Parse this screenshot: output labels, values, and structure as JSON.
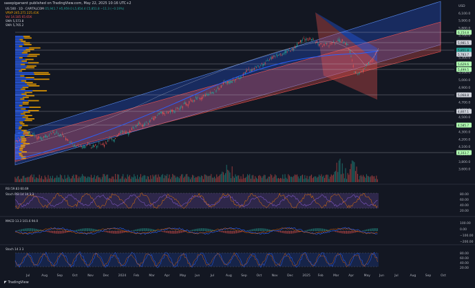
{
  "header": {
    "title": "sasepigarsent published on TradingView.com, May 22, 2025 10:16 UTC+2"
  },
  "legend": {
    "symbol_line": "US 500 · 1D · CAPITALCOM",
    "ohlc": "O5,941.7 H5,959.0 L5,854.4 C5,851.8 −11.3 (−0.19%)",
    "vrvp": "VRVP 245.271 225.41K",
    "vol": "Vol 14.185 65.65K",
    "sma1": "SMA 5,573.8",
    "sma2": "SMA 5,765.2"
  },
  "colors": {
    "background": "#131722",
    "up": "#26a69a",
    "down": "#ef5350",
    "channel_blue": "#2962ff",
    "channel_red": "#ef5350",
    "profile": "#f7a600",
    "ma": "#2962ff"
  },
  "y_axis": {
    "labels": [
      "USD",
      "6,100.0",
      "5,900.0",
      "5,800.0",
      "5,700.0",
      "5,600.0",
      "5,500.0",
      "5,300.0",
      "5,200.0",
      "5,100.0",
      "5,000.0",
      "4,900.0",
      "4,800.0",
      "4,700.0",
      "4,600.0",
      "4,500.0",
      "4,400.0",
      "4,300.0",
      "4,200.0",
      "4,100.0",
      "4,000.0",
      "3,800.0",
      "3,600.0"
    ],
    "price_tags": [
      {
        "text": "6,154.8",
        "color": "#b2ffb2"
      },
      {
        "text": "5,981.5",
        "color": "#d1d4dc"
      },
      {
        "text": "5,851.8",
        "color": "#26a69a"
      },
      {
        "text": "5,783.7",
        "color": "#d1d4dc"
      },
      {
        "text": "5,629.6",
        "color": "#b2ffb2"
      },
      {
        "text": "5,499.5",
        "color": "#b2ffb2"
      },
      {
        "text": "5,068.8",
        "color": "#d1d4dc"
      },
      {
        "text": "4,807.1",
        "color": "#d1d4dc"
      },
      {
        "text": "4,585.7",
        "color": "#b2ffb2"
      },
      {
        "text": "4,103.7",
        "color": "#b2ffb2"
      }
    ]
  },
  "x_axis": {
    "labels": [
      "Jul",
      "Aug",
      "Sep",
      "Oct",
      "Nov",
      "Dec",
      "2024",
      "Feb",
      "Mar",
      "Apr",
      "May",
      "Jun",
      "Jul",
      "Aug",
      "Sep",
      "Oct",
      "Nov",
      "Dec",
      "2025",
      "Feb",
      "Mar",
      "Apr",
      "May",
      "Jun",
      "Jul",
      "Aug",
      "Sep",
      "Oct"
    ]
  },
  "indicators": {
    "rsi": {
      "label": "RSI 59.83 60.69",
      "levels": [
        "80.00",
        "60.00",
        "40.00",
        "20.00"
      ]
    },
    "stoch_rsi": {
      "label": "Stoch RSI 14 14 3 3"
    },
    "macd": {
      "label": "MACD 13.3 101.6 94.0",
      "levels": [
        "100.00",
        "0.00",
        "−100.00",
        "−200.00"
      ]
    },
    "stoch": {
      "label": "Stoch 14 3 3",
      "levels": [
        "80.00",
        "60.00",
        "40.00",
        "20.00"
      ]
    }
  },
  "footer": {
    "brand": "TradingView"
  }
}
